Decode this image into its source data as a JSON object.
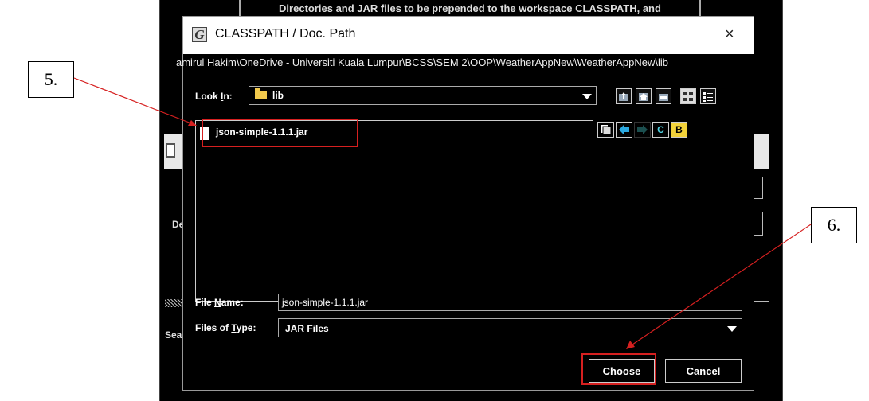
{
  "background_window": {
    "top_text": "Directories and JAR files to be prepended to the workspace CLASSPATH, and",
    "label_de": "De",
    "label_sea": "Sea"
  },
  "dialog": {
    "app_icon_letter": "G",
    "title": "CLASSPATH / Doc. Path",
    "close_glyph": "×",
    "current_path": "amirul Hakim\\OneDrive - Universiti Kuala Lumpur\\BCSS\\SEM 2\\OOP\\WeatherAppNew\\WeatherAppNew\\lib",
    "look_in": {
      "label": "Look In:",
      "mnemonic": "I",
      "value": "lib"
    },
    "toolbar_icons": [
      "up-folder-icon",
      "home-icon",
      "new-folder-icon",
      "list-view-icon",
      "details-view-icon"
    ],
    "files": [
      {
        "name": "json-simple-1.1.1.jar",
        "icon": "file-icon"
      }
    ],
    "side_toolbar": {
      "icons": [
        "copy-icon",
        "back-arrow-icon",
        "forward-arrow-icon"
      ],
      "refresh_label": "C",
      "bookmark_label": "B"
    },
    "file_name": {
      "label": "File Name:",
      "mnemonic": "N",
      "value": "json-simple-1.1.1.jar"
    },
    "files_of_type": {
      "label": "Files of Type:",
      "mnemonic": "T",
      "value": "JAR Files"
    },
    "buttons": {
      "choose": "Choose",
      "cancel": "Cancel"
    }
  },
  "annotations": {
    "callout_5": "5.",
    "callout_6": "6.",
    "highlight_color": "#d62020"
  }
}
